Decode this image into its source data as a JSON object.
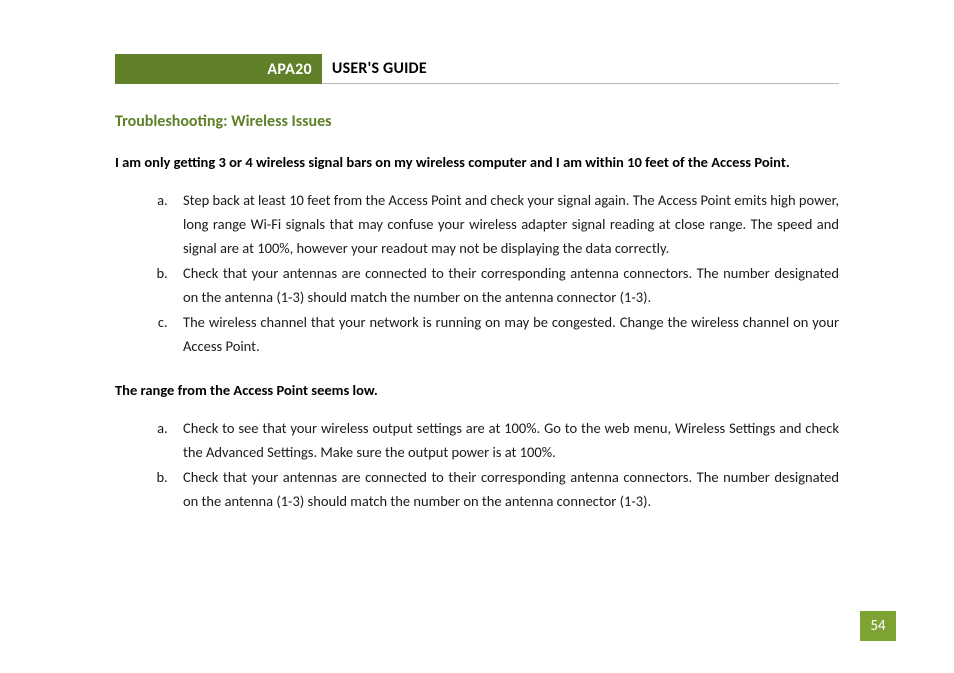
{
  "header": {
    "badge": "APA20",
    "title": "USER'S GUIDE"
  },
  "section_title": "Troubleshooting: Wireless Issues",
  "issues": [
    {
      "problem": "I am only getting 3 or 4 wireless signal bars on my wireless computer and I am within 10 feet of the Access Point.",
      "steps": [
        "Step back at least 10 feet from the Access Point and check your signal again. The Access Point emits high power, long range Wi-Fi signals that may confuse your wireless adapter signal reading at close range. The speed and signal are at 100%, however your readout may not be displaying the data correctly.",
        "Check that your antennas are connected to their corresponding antenna connectors. The number designated on the antenna (1-3) should match the number on the antenna connector (1-3).",
        "The wireless channel that your network is running on may be congested. Change the wireless channel on your Access Point."
      ]
    },
    {
      "problem": "The range from the Access Point seems low.",
      "steps": [
        "Check to see that your wireless output settings are at 100%. Go to the web menu, Wireless Settings and check the Advanced Settings. Make sure the output power is at 100%.",
        "Check that your antennas are connected to their corresponding antenna connectors. The number designated on the antenna (1-3) should match the number on the antenna connector (1-3)."
      ]
    }
  ],
  "page_number": "54"
}
